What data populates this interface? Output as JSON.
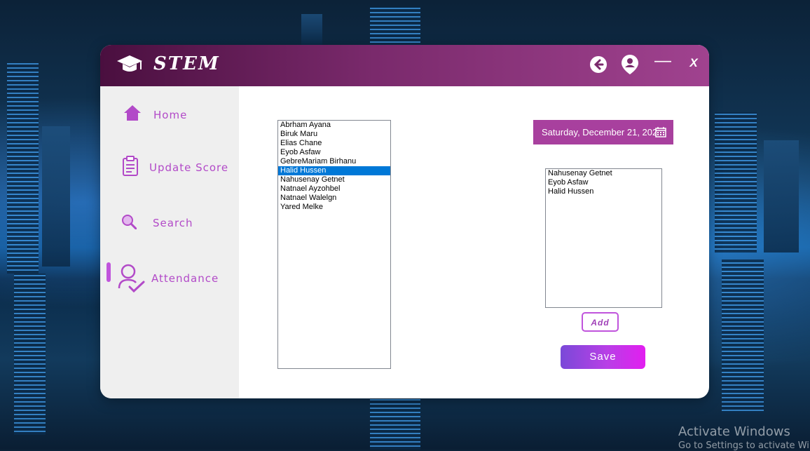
{
  "app": {
    "title": "STEM"
  },
  "sidebar": {
    "items": [
      {
        "label": "Home",
        "icon": "home-icon"
      },
      {
        "label": "Update  Score",
        "icon": "clipboard-icon"
      },
      {
        "label": "Search",
        "icon": "search-icon"
      },
      {
        "label": "Attendance",
        "icon": "attendance-icon",
        "active": true
      }
    ]
  },
  "students": {
    "items": [
      "Abrham Ayana",
      "Biruk Maru",
      "Elias Chane",
      "Eyob Asfaw",
      "GebreMariam Birhanu",
      "Halid Hussen",
      "Nahusenay  Getnet",
      "Natnael Ayzohbel",
      "Natnael Walelgn",
      "Yared Melke"
    ],
    "selected": "Halid Hussen"
  },
  "date": {
    "value": "Saturday, December 21, 2024"
  },
  "attendance": {
    "items": [
      "Nahusenay  Getnet",
      "Eyob Asfaw",
      "Halid Hussen"
    ]
  },
  "buttons": {
    "add": "Add",
    "save": "Save"
  },
  "watermark": {
    "line1": "Activate Windows",
    "line2": "Go to Settings to activate Windows."
  },
  "colors": {
    "accent": "#b24ac8",
    "titlebar": "#7a2a6c",
    "selection": "#0078d7"
  }
}
